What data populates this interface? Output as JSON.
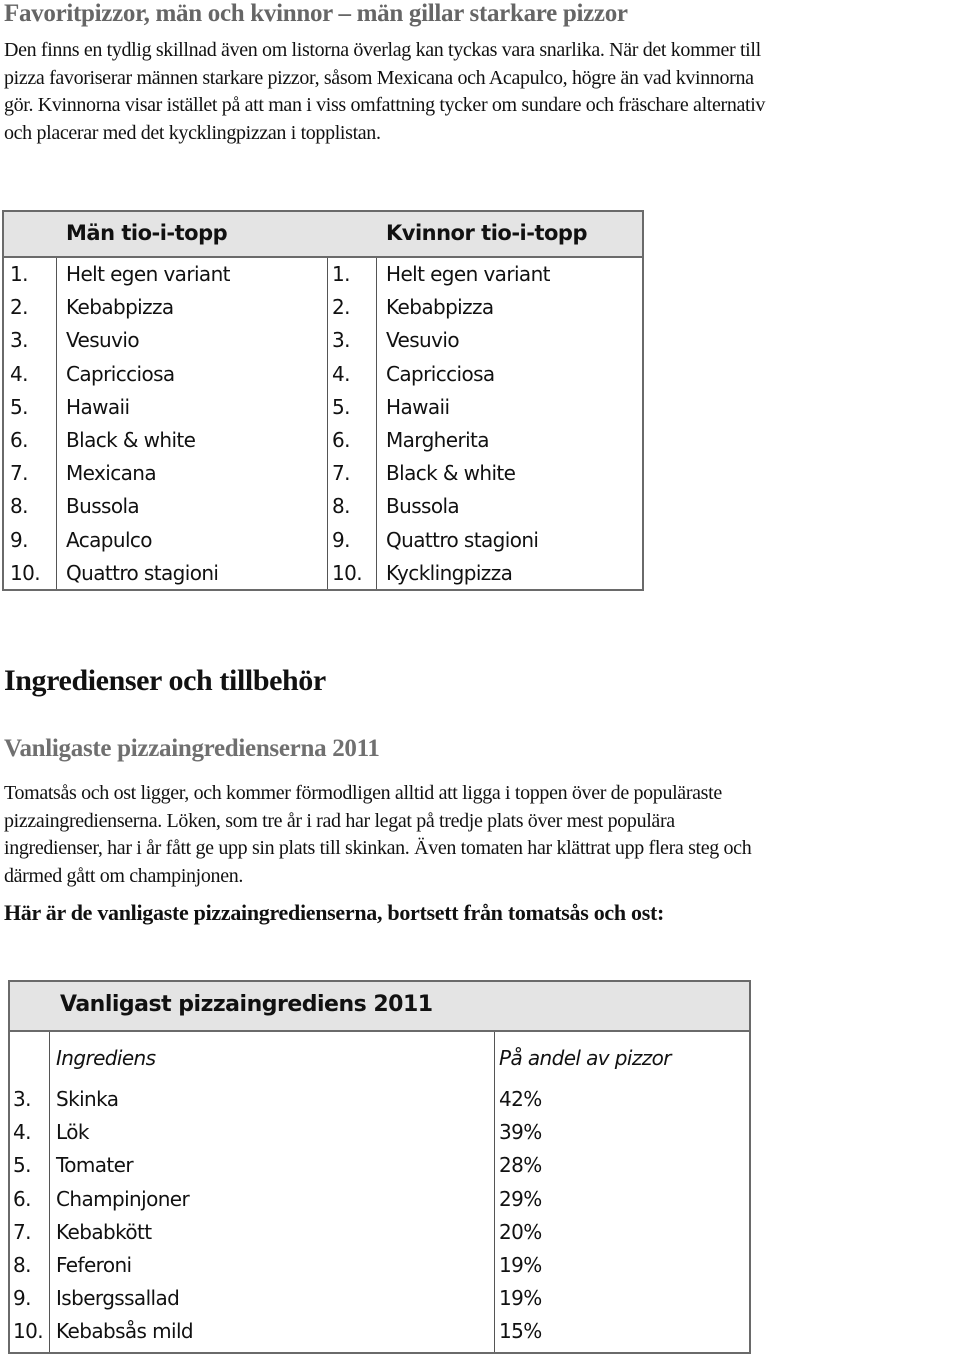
{
  "section1": {
    "title": "Favoritpizzor, män och kvinnor – män gillar starkare pizzor",
    "paragraph_lines": [
      "Den finns en tydlig skillnad även om listorna överlag kan tyckas vara snarlika. När det kommer till",
      "pizza favoriserar männen starkare pizzor, såsom Mexicana och Acapulco, högre än vad kvinnorna",
      "gör.  Kvinnorna visar istället på att man i viss omfattning tycker om sundare och fräschare alternativ",
      "och placerar med det kycklingpizzan i topplistan."
    ]
  },
  "top_ten_table": {
    "men_header": "Män tio-i-topp",
    "women_header": "Kvinnor tio-i-topp",
    "men": [
      {
        "rank": "1.",
        "name": "Helt egen variant"
      },
      {
        "rank": "2.",
        "name": "Kebabpizza"
      },
      {
        "rank": "3.",
        "name": "Vesuvio"
      },
      {
        "rank": "4.",
        "name": "Capricciosa"
      },
      {
        "rank": "5.",
        "name": "Hawaii"
      },
      {
        "rank": "6.",
        "name": "Black & white"
      },
      {
        "rank": "7.",
        "name": "Mexicana"
      },
      {
        "rank": "8.",
        "name": "Bussola"
      },
      {
        "rank": "9.",
        "name": "Acapulco"
      },
      {
        "rank": "10.",
        "name": "Quattro stagioni"
      }
    ],
    "women": [
      {
        "rank": "1.",
        "name": "Helt egen variant"
      },
      {
        "rank": "2.",
        "name": "Kebabpizza"
      },
      {
        "rank": "3.",
        "name": "Vesuvio"
      },
      {
        "rank": "4.",
        "name": "Capricciosa"
      },
      {
        "rank": "5.",
        "name": "Hawaii"
      },
      {
        "rank": "6.",
        "name": "Margherita"
      },
      {
        "rank": "7.",
        "name": "Black & white"
      },
      {
        "rank": "8.",
        "name": "Bussola"
      },
      {
        "rank": "9.",
        "name": "Quattro stagioni"
      },
      {
        "rank": "10.",
        "name": "Kycklingpizza"
      }
    ]
  },
  "section2": {
    "title": "Ingredienser och tillbehör",
    "subtitle": "Vanligaste pizzaingredienserna 2011",
    "paragraph_lines": [
      "Tomatsås och ost ligger, och kommer förmodligen alltid att ligga i toppen över de populäraste",
      "pizzaingredienserna. Löken, som tre år i rad har legat på tredje plats över mest populära",
      "ingredienser, har i år fått ge upp sin plats till skinkan. Även tomaten har klättrat upp flera steg och",
      "därmed gått om champinjonen."
    ],
    "lead": "Här är de vanligaste pizzaingredienserna, bortsett från tomatsås och ost:"
  },
  "ingredients_table": {
    "title": "Vanligast pizzaingrediens 2011",
    "col_ingredient": "Ingrediens",
    "col_share": "På andel av pizzor",
    "rows": [
      {
        "rank": "3.",
        "name": "Skinka",
        "share": "42%"
      },
      {
        "rank": "4.",
        "name": "Lök",
        "share": "39%"
      },
      {
        "rank": "5.",
        "name": "Tomater",
        "share": "28%"
      },
      {
        "rank": "6.",
        "name": "Champinjoner",
        "share": "29%"
      },
      {
        "rank": "7.",
        "name": "Kebabkött",
        "share": "20%"
      },
      {
        "rank": "8.",
        "name": "Feferoni",
        "share": "19%"
      },
      {
        "rank": "9.",
        "name": "Isbergssallad",
        "share": "19%"
      },
      {
        "rank": "10.",
        "name": "Kebabsås mild",
        "share": "15%"
      }
    ]
  }
}
